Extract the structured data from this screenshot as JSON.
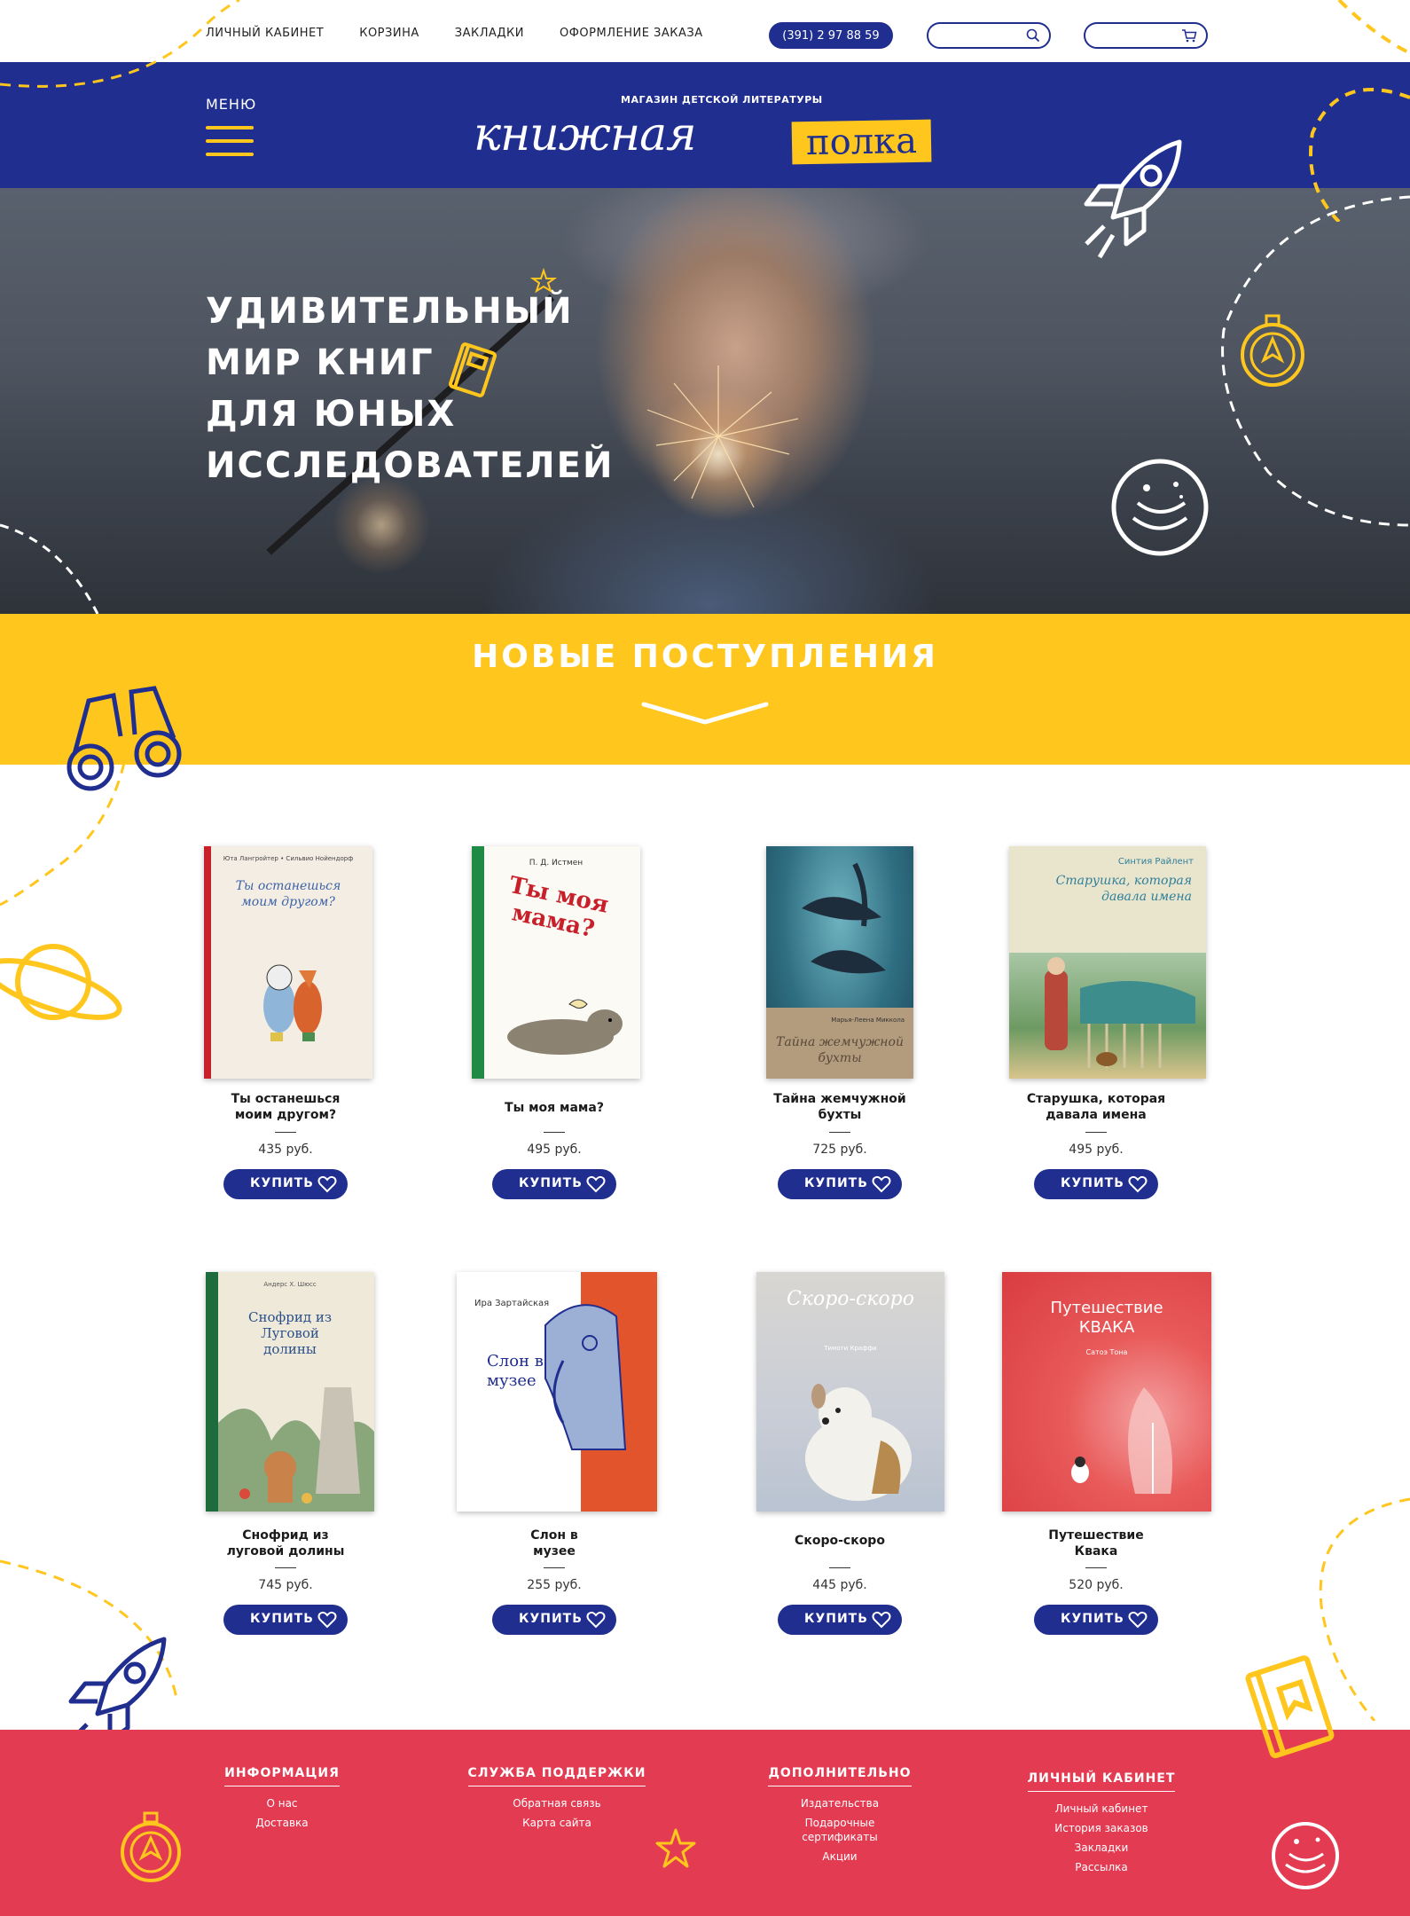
{
  "topnav": [
    "Личный кабинет",
    "Корзина",
    "Закладки",
    "Оформление заказа"
  ],
  "phone": "(391) 2 97 88 59",
  "search": {
    "placeholder": ""
  },
  "header": {
    "menu_label": "МЕНЮ",
    "logo_subtitle": "МАГАЗИН ДЕТСКОЙ ЛИТЕРАТУРЫ",
    "logo_main": "книжная",
    "logo_tag": "полка"
  },
  "hero": {
    "lines": [
      "Удивительный",
      "мир книг",
      "для юных",
      "исследователей"
    ]
  },
  "new_arrivals": {
    "title": "НОВЫЕ ПОСТУПЛЕНИЯ"
  },
  "buy_label": "КУПИТЬ",
  "products": [
    {
      "title": "Ты останешься моим другом?",
      "price": "435 руб.",
      "cover_author": "Юта Лангройтер • Сильвио Нойендорф",
      "cover_title": "Ты останешься моим другом?",
      "cover_bg": "#f4ede3",
      "accent": "#c8202a"
    },
    {
      "title": "Ты моя мама?",
      "price": "495 руб.",
      "cover_author": "П. Д. Истмен",
      "cover_title": "Ты моя мама?",
      "cover_bg": "#fbfaf4",
      "accent": "#1e8a43"
    },
    {
      "title": "Тайна жемчужной бухты",
      "price": "725 руб.",
      "cover_author": "Марья-Леена Миккола",
      "cover_title": "Тайна жемчужной бухты",
      "cover_bg": "#2f6e82",
      "accent": "#b39b7d"
    },
    {
      "title": "Старушка, которая давала имена",
      "price": "495 руб.",
      "cover_author": "Синтия Райлент",
      "cover_title": "Старушка, которая давала имена",
      "cover_bg": "#e9e5cd",
      "accent": "#2f7f9a"
    },
    {
      "title": "Снофрид из луговой долины",
      "price": "745 руб.",
      "cover_author": "Андерс Х. Шюсс",
      "cover_title": "Снофрид из Луговой долины",
      "cover_bg": "#efe9da",
      "accent": "#1e6b3d"
    },
    {
      "title": "Слон в музее",
      "price": "255 руб.",
      "cover_author": "Ира Зартайская",
      "cover_title": "Слон в музее",
      "cover_bg": "#ffffff",
      "accent": "#e2542b"
    },
    {
      "title": "Скоро-скоро",
      "price": "445 руб.",
      "cover_author": "Тимоти Краффи",
      "cover_title": "Скоро-скоро",
      "cover_bg": "#d6d4d0",
      "accent": "#aab6c6"
    },
    {
      "title": "Путешествие Квака",
      "price": "520 руб.",
      "cover_author": "Сатоэ Тона",
      "cover_title": "Путешествие КВАКА",
      "cover_bg": "#e24a4a",
      "accent": "#f06a63"
    }
  ],
  "footer": {
    "columns": [
      {
        "heading": "ИНФОРМАЦИЯ",
        "links": [
          "О нас",
          "Доставка"
        ]
      },
      {
        "heading": "СЛУЖБА ПОДДЕРЖКИ",
        "links": [
          "Обратная связь",
          "Карта сайта"
        ]
      },
      {
        "heading": "ДОПОЛНИТЕЛЬНО",
        "links": [
          "Издательства",
          "Подарочные сертификаты",
          "Акции"
        ]
      },
      {
        "heading": "ЛИЧНЫЙ КАБИНЕТ",
        "links": [
          "Личный кабинет",
          "История заказов",
          "Закладки",
          "Рассылка"
        ]
      }
    ]
  },
  "colors": {
    "brand_blue": "#1f2e8f",
    "brand_yellow": "#ffc61e",
    "footer_red": "#e23b52"
  },
  "icons": [
    "search-icon",
    "cart-icon",
    "menu-icon",
    "heart-icon",
    "rocket-icon",
    "compass-icon",
    "planet-icon",
    "binoculars-icon",
    "book-icon",
    "star-icon",
    "chevron-down-icon"
  ]
}
